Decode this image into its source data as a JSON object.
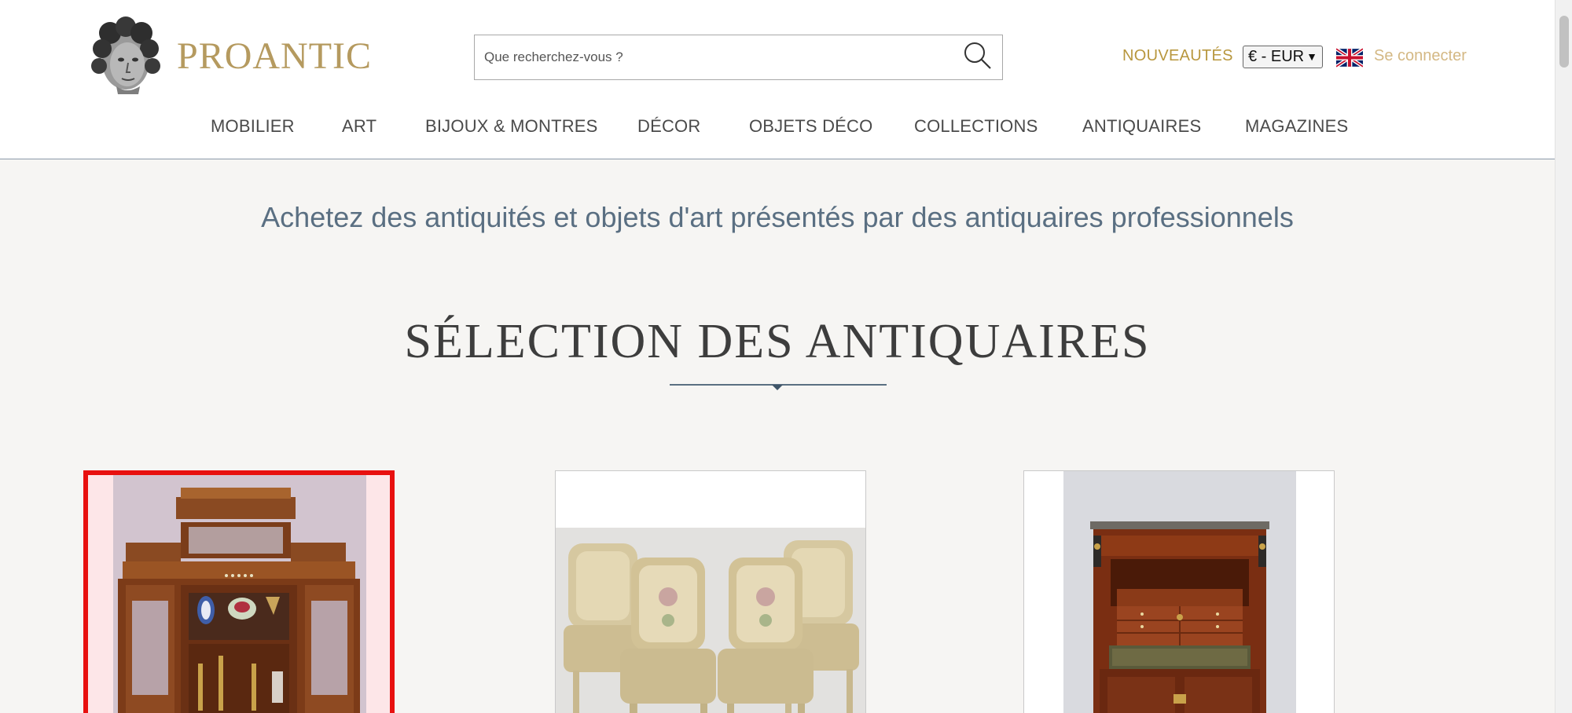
{
  "header": {
    "logo_text": "PROANTIC",
    "search": {
      "placeholder": "Que recherchez-vous ?"
    },
    "nouveautes_label": "NOUVEAUTÉS",
    "currency": {
      "selected": "€ - EUR"
    },
    "language_flag": "uk-flag-icon",
    "login_label": "Se connecter"
  },
  "nav": {
    "items": [
      {
        "label": "MOBILIER"
      },
      {
        "label": "ART"
      },
      {
        "label": "BIJOUX & MONTRES"
      },
      {
        "label": "DÉCOR"
      },
      {
        "label": "OBJETS DÉCO"
      },
      {
        "label": "COLLECTIONS"
      },
      {
        "label": "ANTIQUAIRES"
      },
      {
        "label": "MAGAZINES"
      }
    ]
  },
  "main": {
    "tagline": "Achetez des antiquités et objets d'art présentés par des antiquaires professionnels",
    "section_title": "SÉLECTION DES ANTIQUAIRES"
  },
  "products": [
    {
      "image": "display-cabinet-image",
      "selected": true
    },
    {
      "image": "four-armchairs-image",
      "selected": false
    },
    {
      "image": "secretaire-desk-image",
      "selected": false
    }
  ],
  "colors": {
    "brand_gold": "#b59a5f",
    "nav_text": "#4a4a4a",
    "tagline_blue": "#5a6f82",
    "selection_red": "#e8100f"
  }
}
